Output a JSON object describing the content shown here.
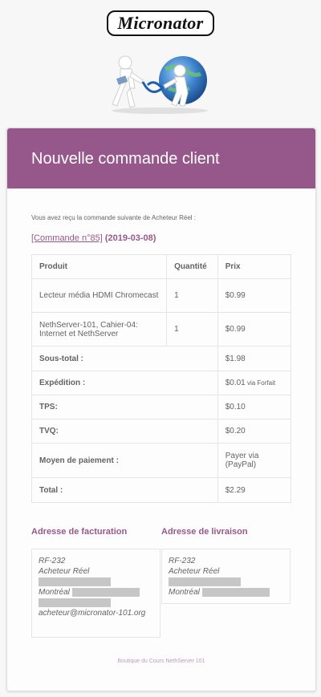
{
  "brand": {
    "logo_text": "Micronator"
  },
  "email": {
    "heading": "Nouvelle commande client",
    "intro": "Vous avez reçu la commande suivante de Acheteur Réel :",
    "order_link": "[Commande n°85]",
    "order_date": " (2019-03-08)",
    "columns": {
      "product": "Produit",
      "quantity": "Quantité",
      "price": "Prix"
    },
    "items": [
      {
        "product": "Lecteur média HDMI Chromecast",
        "quantity": "1",
        "price": "$0.99"
      },
      {
        "product": "NethServer-101, Cahier-04: Internet et NethServer",
        "quantity": "1",
        "price": "$0.99"
      }
    ],
    "totals": {
      "subtotal_label": "Sous-total :",
      "subtotal_value": "$1.98",
      "shipping_label": "Expédition :",
      "shipping_value": "$0.01",
      "shipping_note": " via Forfait",
      "tps_label": "TPS:",
      "tps_value": "$0.10",
      "tvq_label": "TVQ:",
      "tvq_value": "$0.20",
      "payment_label": "Moyen de paiement :",
      "payment_value": "Payer via (PayPal)",
      "total_label": "Total :",
      "total_value": "$2.29"
    },
    "billing": {
      "title": "Adresse de facturation",
      "line1": "RF-232",
      "line2": "Acheteur Réel",
      "city": "Montréal",
      "email": "acheteur@micronator-101.org"
    },
    "shipping": {
      "title": "Adresse de livraison",
      "line1": "RF-232",
      "line2": "Acheteur Réel",
      "city": "Montréal"
    },
    "footer": "Boutique du Cours NethServer 101"
  }
}
